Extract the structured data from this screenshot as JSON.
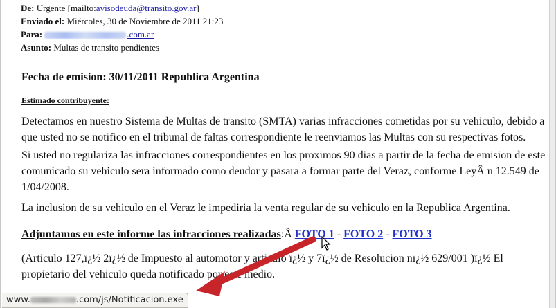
{
  "headers": {
    "from_label": "De:",
    "from_value": "Urgente [mailto:",
    "from_email": "avisodeuda@transito.gov.ar",
    "from_close": "]",
    "sent_label": "Enviado el:",
    "sent_value": "Miércoles, 30 de Noviembre de 2011 21:23",
    "to_label": "Para:",
    "to_email_suffix": ".com.ar",
    "subject_label": "Asunto:",
    "subject_value": "Multas de transito pendientes"
  },
  "body": {
    "title": "Fecha de emision: 30/11/2011 Republica Argentina",
    "salutation": "Estimado contribuyente:",
    "p1": "Detectamos en nuestro Sistema de Multas de transito (SMTA) varias infracciones cometidas por su vehiculo, debido a que usted no se notifico en el tribunal de faltas correspondiente le reenviamos las Multas con su respectivas fotos.",
    "p2": "Si usted no regulariza las infracciones correspondientes en los proximos 90 dias a partir de la fecha de emision de este comunicado su vehiculo sera informado como deudor y pasara a formar parte del Veraz, conforme LeyÂ  n 12.549 de 1/04/2008.",
    "p3": "La inclusion de su vehiculo en el Veraz le impediria la venta regular de su vehiculo en la Republica Argentina.",
    "attach_label": "Adjuntamos en este informe las infracciones realizadas",
    "attach_suffix": ":Â ",
    "links": [
      "FOTO 1",
      "FOTO 2",
      "FOTO 3"
    ],
    "link_separator": "-",
    "p5": "(Articulo 127,ï¿½ 2ï¿½ de Impuesto al automotor y articulo ï¿½ y 7ï¿½ de Resolucion nï¿½ 629/001 )ï¿½ El propietario del vehiculo queda notificado por este medio."
  },
  "statusbar": {
    "prefix": "www.",
    "suffix": ".com/js/Notificacion.exe"
  },
  "colors": {
    "link": "#1f2fc8",
    "arrow": "#c8252a",
    "email_link": "#1c1ca8"
  },
  "icons": {
    "pointer": "mouse-pointer-icon",
    "annotation": "red-arrow-annotation"
  }
}
